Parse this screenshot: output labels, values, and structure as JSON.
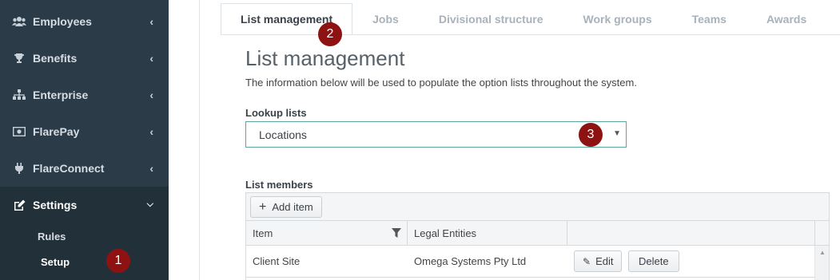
{
  "sidebar": {
    "items": [
      {
        "label": "Employees",
        "icon": "users-icon"
      },
      {
        "label": "Benefits",
        "icon": "trophy-icon"
      },
      {
        "label": "Enterprise",
        "icon": "sitemap-icon"
      },
      {
        "label": "FlarePay",
        "icon": "money-icon"
      },
      {
        "label": "FlareConnect",
        "icon": "plug-icon"
      },
      {
        "label": "Settings",
        "icon": "edit-icon"
      }
    ],
    "subitems": [
      {
        "label": "Rules"
      },
      {
        "label": "Setup"
      }
    ]
  },
  "badges": {
    "one": "1",
    "two": "2",
    "three": "3"
  },
  "tabs": [
    {
      "label": "List management"
    },
    {
      "label": "Jobs"
    },
    {
      "label": "Divisional structure"
    },
    {
      "label": "Work groups"
    },
    {
      "label": "Teams"
    },
    {
      "label": "Awards"
    }
  ],
  "main": {
    "title": "List management",
    "description": "The information below will be used to populate the option lists throughout the system.",
    "lookup_label": "Lookup lists",
    "lookup_value": "Locations",
    "members_label": "List members",
    "add_item_label": "Add item",
    "columns": [
      "Item",
      "Legal Entities"
    ],
    "rows": [
      {
        "item": "Client Site",
        "legal_entities": "Omega Systems Pty Ltd",
        "edit_label": "Edit",
        "delete_label": "Delete"
      }
    ]
  },
  "colors": {
    "sidebar": "#2c3b48",
    "badge": "#8f1212",
    "accent": "#5aa7a2"
  }
}
